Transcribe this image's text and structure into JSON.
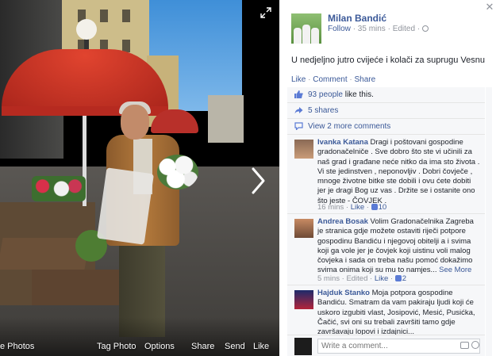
{
  "photo_bar": {
    "photos_label": "e Photos",
    "tag_label": "Tag Photo",
    "options_label": "Options",
    "share_label": "Share",
    "send_label": "Send",
    "like_label": "Like"
  },
  "post": {
    "author": "Milan Bandić",
    "follow_label": "Follow",
    "time": "35 mins",
    "edited": "Edited",
    "text": "U nedjeljno jutro cvijeće i kolači za suprugu Vesnu",
    "actions": {
      "like": "Like",
      "comment": "Comment",
      "share": "Share"
    }
  },
  "ufi": {
    "likes_count": "93 people",
    "likes_rest": "like this.",
    "shares": "5 shares",
    "view_more": "View 2 more comments"
  },
  "comments": [
    {
      "name": "Ivanka Katana",
      "text": "Dragi i poštovani gospodine gradonačelniče . Sve dobro što ste vi učinili za naš grad i građane neće nitko da ima sto života . Vi ste jedinstven , neponovljiv . Dobri čovječe , mnoge životne bitke ste dobili i ovu ćete dobiti jer je dragi Bog uz vas . Držite se i ostanite ono što jeste - ČOVJEK .",
      "time": "16 mins",
      "like": "Like",
      "likes": "10"
    },
    {
      "name": "Andrea Bosak",
      "text": "Volim Gradonačelnika Zagreba je stranica gdje možete ostaviti riječi potpore gospodinu Bandiću i njegovoj obitelji a i svima koji ga vole jer je čovjek koji uistinu voli malog čovjeka i sada on treba našu pomoć dokažimo svima onima koji su mu to namjes...",
      "see_more": "See More",
      "time": "5 mins",
      "edited": "Edited",
      "like": "Like",
      "likes": "2"
    },
    {
      "name": "Hajduk Stanko",
      "text": "Moja potpora gospodine Bandiću. Smatram da vam pakiraju ljudi koji će uskoro izgubiti vlast, Josipović, Mesić, Pusićka, Čačić, svi oni su trebali završiti tamo gdje završavaju lopovi i izdajnici..."
    }
  ],
  "write_comment": {
    "placeholder": "Write a comment..."
  },
  "icons": {
    "close": "close-icon",
    "expand": "expand-icon",
    "next": "chevron-right-icon",
    "camera": "camera-icon",
    "emoji": "emoji-icon",
    "globe": "globe-icon"
  },
  "colors": {
    "link": "#3b5998",
    "muted": "#90949c",
    "ufi_bg": "#f6f7f9",
    "stage_bg": "#000000"
  }
}
